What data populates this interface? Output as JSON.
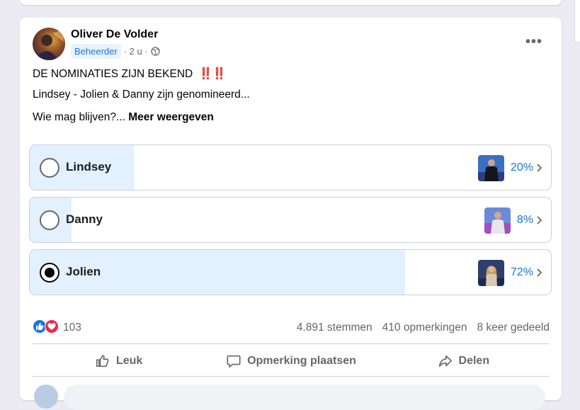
{
  "post": {
    "author": "Oliver De Volder",
    "role_badge": "Beheerder",
    "time": "· 2 u ·",
    "line1": "DE NOMINATIES ZIJN BEKEND",
    "line1_emoji": "‼️‼️",
    "line2": "Lindsey - Jolien & Danny zijn genomineerd...",
    "line3": "Wie mag blijven?...",
    "see_more": "Meer weergeven",
    "more_icon": "•••"
  },
  "poll": {
    "options": [
      {
        "label": "Lindsey",
        "percent": "20%",
        "fill": 0.2,
        "selected": false
      },
      {
        "label": "Danny",
        "percent": "8%",
        "fill": 0.08,
        "selected": false
      },
      {
        "label": "Jolien",
        "percent": "72%",
        "fill": 0.72,
        "selected": true
      }
    ]
  },
  "footer": {
    "reaction_count": "103",
    "votes": "4.891 stemmen",
    "comments": "410 opmerkingen",
    "shares": "8 keer gedeeld"
  },
  "actions": {
    "like": "Leuk",
    "comment": "Opmerking plaatsen",
    "share": "Delen"
  },
  "colors": {
    "accent": "#1b74e4",
    "poll_fill": "#e3f0fd",
    "like_blue": "#1b74e4",
    "love_red": "#f02849"
  }
}
